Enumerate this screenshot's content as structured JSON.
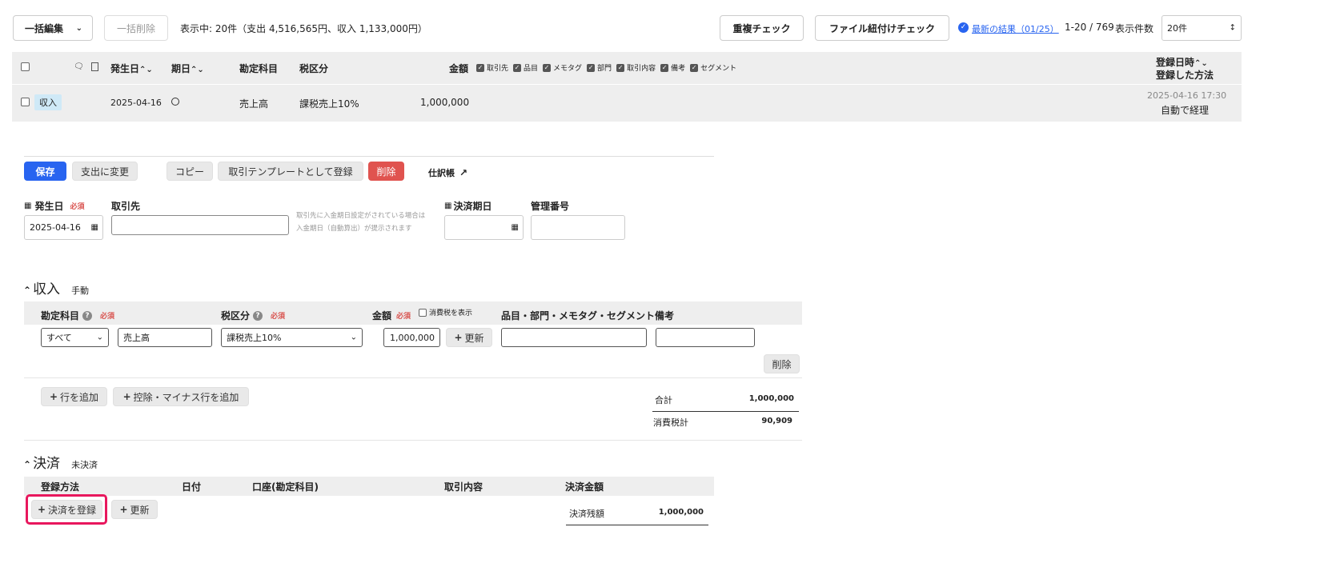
{
  "toolbar": {
    "bulk_edit": "一括編集",
    "bulk_delete": "一括削除",
    "summary": "表示中: 20件（支出 4,516,565円、収入 1,133,000円）",
    "duplicate_check": "重複チェック",
    "file_link_check": "ファイル紐付けチェック",
    "latest_result": "最新の結果（01/25）",
    "paging": "1-20 / 769",
    "per_page_label": "表示件数",
    "per_page_value": "20件"
  },
  "table_header": {
    "date": "発生日",
    "due": "期日",
    "account": "勘定科目",
    "tax": "税区分",
    "amount": "金額",
    "toggles": [
      "取引先",
      "品目",
      "メモタグ",
      "部門",
      "取引内容",
      "備考",
      "セグメント"
    ],
    "registered_at": "登録日時",
    "registered_by": "登録した方法"
  },
  "row": {
    "type": "収入",
    "date": "2025-04-16",
    "account": "売上高",
    "tax": "課税売上10%",
    "amount": "1,000,000",
    "registered_at": "2025-04-16 17:30",
    "registered_by": "自動で経理"
  },
  "actions": {
    "save": "保存",
    "change_to_expense": "支出に変更",
    "copy": "コピー",
    "register_template": "取引テンプレートとして登録",
    "delete": "削除",
    "journal": "仕訳帳"
  },
  "form": {
    "date_label": "発生日",
    "required": "必須",
    "date_value": "2025-04-16",
    "partner_label": "取引先",
    "partner_hint_1": "取引先に入金期日設定がされている場合は",
    "partner_hint_2": "入金期日（自動算出）が提示されます",
    "due_label": "決済期日",
    "mgmt_label": "管理番号"
  },
  "income": {
    "title": "収入",
    "mode": "手動",
    "col_account": "勘定科目",
    "col_tax": "税区分",
    "col_amount": "金額",
    "show_tax": "消費税を表示",
    "col_items": "品目・部門・メモタグ・セグメント",
    "col_note": "備考",
    "account_filter": "すべて",
    "account_value": "売上高",
    "tax_value": "課税売上10%",
    "amount_value": "1,000,000",
    "update": "更新",
    "delete": "削除",
    "add_row": "行を追加",
    "add_minus_row": "控除・マイナス行を追加",
    "total_label": "合計",
    "total_value": "1,000,000",
    "tax_total_label": "消費税計",
    "tax_total_value": "90,909"
  },
  "settlement": {
    "title": "決済",
    "status": "未決済",
    "col_method": "登録方法",
    "col_date": "日付",
    "col_account": "口座(勘定科目)",
    "col_content": "取引内容",
    "col_amount": "決済金額",
    "register": "決済を登録",
    "update": "更新",
    "balance_label": "決済残額",
    "balance_value": "1,000,000"
  },
  "colors": {
    "primary": "#2864f0",
    "danger": "#e0534f",
    "highlight": "#e8175d",
    "income_badge": "#cfe9f7"
  }
}
